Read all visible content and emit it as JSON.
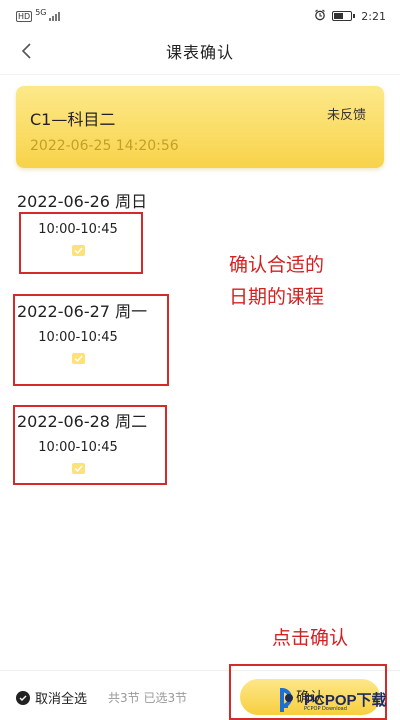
{
  "status_bar": {
    "network": "5G",
    "hd": "HD",
    "time": "2:21"
  },
  "nav": {
    "title": "课表确认"
  },
  "card": {
    "title": "C1—科目二",
    "status": "未反馈",
    "time": "2022-06-25 14:20:56"
  },
  "days": [
    {
      "date": "2022-06-26 周日",
      "slot": "10:00-10:45",
      "selected": true
    },
    {
      "date": "2022-06-27 周一",
      "slot": "10:00-10:45",
      "selected": true
    },
    {
      "date": "2022-06-28 周二",
      "slot": "10:00-10:45",
      "selected": true
    }
  ],
  "annotations": {
    "hint_line1": "确认合适的",
    "hint_line2": "日期的课程",
    "confirm_hint": "点击确认"
  },
  "bottom": {
    "select_all": "取消全选",
    "count": "共3节 已选3节",
    "confirm": "确认"
  },
  "watermark": {
    "brand": "PCPOP下载",
    "sub": "PCPOP Download"
  },
  "colors": {
    "accent": "#f8d34a",
    "annotation": "#d42020"
  },
  "icons": [
    "back-arrow-icon",
    "alarm-icon",
    "battery-icon",
    "checkbox-icon",
    "check-circle-icon"
  ]
}
